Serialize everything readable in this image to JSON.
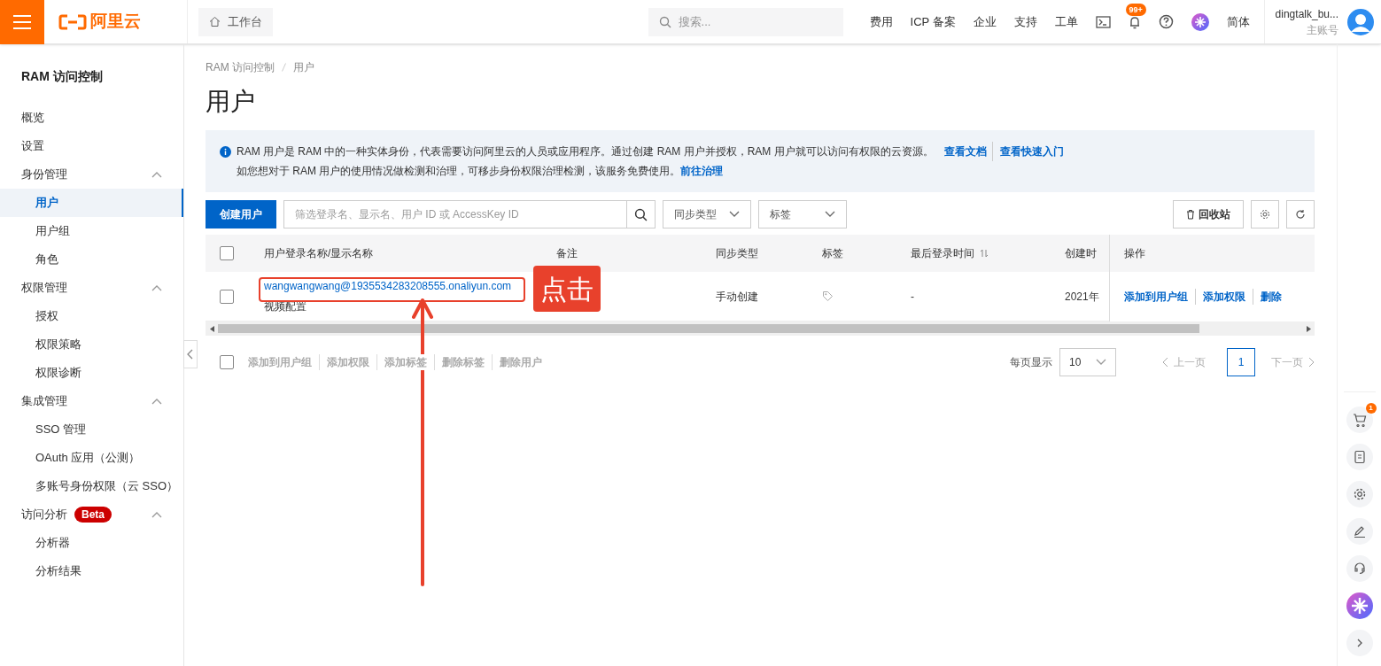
{
  "header": {
    "logo": "阿里云",
    "workbench": "工作台",
    "search_placeholder": "搜索...",
    "nav": [
      "费用",
      "ICP 备案",
      "企业",
      "支持",
      "工单"
    ],
    "notification_badge": "99+",
    "language": "简体",
    "account_name": "dingtalk_bu...",
    "account_type": "主账号"
  },
  "sidebar": {
    "title": "RAM 访问控制",
    "items": [
      {
        "label": "概览",
        "selected": false
      },
      {
        "label": "设置",
        "selected": false
      },
      {
        "label": "身份管理",
        "expanded": true,
        "children": [
          {
            "label": "用户",
            "selected": true
          },
          {
            "label": "用户组",
            "selected": false
          },
          {
            "label": "角色",
            "selected": false
          }
        ]
      },
      {
        "label": "权限管理",
        "expanded": true,
        "children": [
          {
            "label": "授权",
            "selected": false
          },
          {
            "label": "权限策略",
            "selected": false
          },
          {
            "label": "权限诊断",
            "selected": false
          }
        ]
      },
      {
        "label": "集成管理",
        "expanded": true,
        "children": [
          {
            "label": "SSO 管理",
            "selected": false
          },
          {
            "label": "OAuth 应用（公测）",
            "selected": false
          },
          {
            "label": "多账号身份权限（云 SSO）",
            "selected": false
          }
        ]
      },
      {
        "label": "访问分析",
        "badge": "Beta",
        "expanded": true,
        "children": [
          {
            "label": "分析器",
            "selected": false
          },
          {
            "label": "分析结果",
            "selected": false
          }
        ]
      }
    ]
  },
  "breadcrumb": [
    "RAM 访问控制",
    "用户"
  ],
  "page_title": "用户",
  "notice": {
    "line1": "RAM 用户是 RAM 中的一种实体身份，代表需要访问阿里云的人员或应用程序。通过创建 RAM 用户并授权，RAM 用户就可以访问有权限的云资源。",
    "links1": [
      "查看文档",
      "查看快速入门"
    ],
    "line2": "如您想对于 RAM 用户的使用情况做检测和治理，可移步身份权限治理检测，该服务免费使用。",
    "link2": "前往治理"
  },
  "toolbar": {
    "create_button": "创建用户",
    "filter_placeholder": "筛选登录名、显示名、用户 ID 或 AccessKey ID",
    "selects": [
      "同步类型",
      "标签"
    ],
    "recycle_button": "回收站"
  },
  "table": {
    "columns": [
      "用户登录名称/显示名称",
      "备注",
      "同步类型",
      "标签",
      "最后登录时间",
      "创建时",
      "操作"
    ],
    "rows": [
      {
        "checked": false,
        "login_name": "wangwangwang@1935534283208555.onaliyun.com",
        "display_name": "视频配置",
        "sync_type": "手动创建",
        "last_login": "-",
        "created": "2021年",
        "actions": [
          "添加到用户组",
          "添加权限",
          "删除"
        ]
      }
    ]
  },
  "batch": {
    "checked": false,
    "actions": [
      "添加到用户组",
      "添加权限",
      "添加标签",
      "删除标签",
      "删除用户"
    ]
  },
  "pagination": {
    "page_size_label": "每页显示",
    "page_size": "10",
    "prev": "上一页",
    "pages": [
      {
        "label": "1",
        "selected": true
      }
    ],
    "next": "下一页"
  },
  "annotation": {
    "label": "点击"
  },
  "right_rail": {
    "cart_badge": "1"
  }
}
